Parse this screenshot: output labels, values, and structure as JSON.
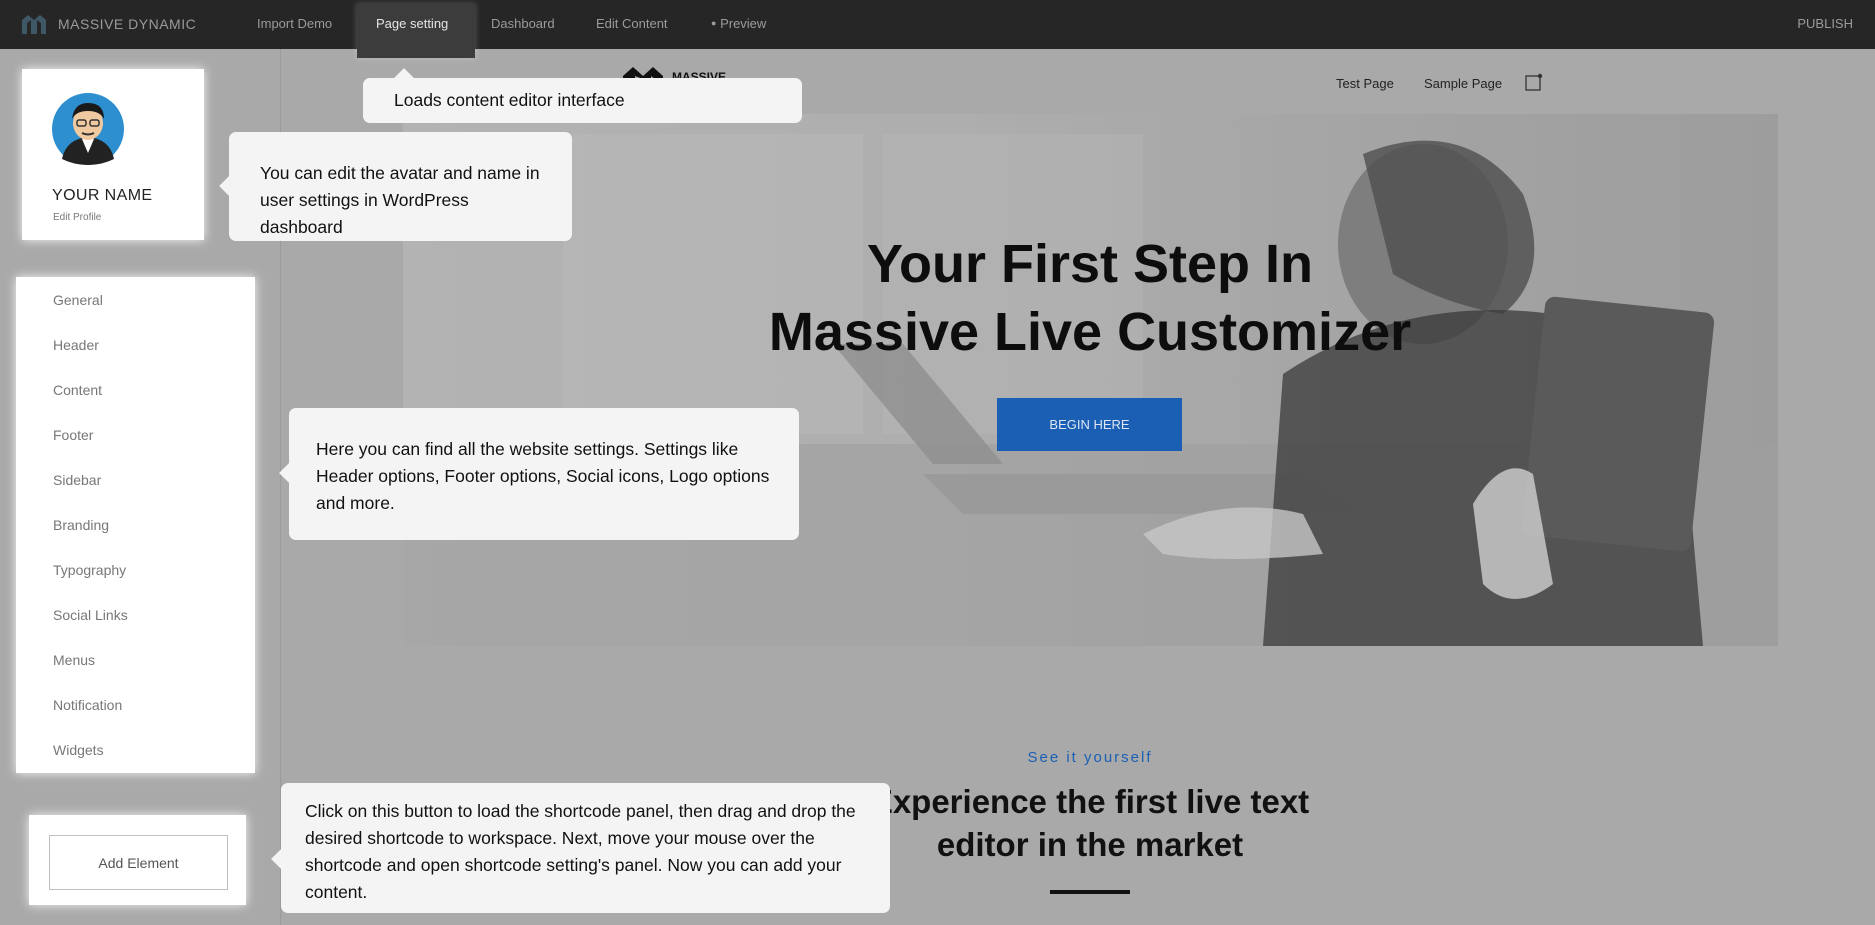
{
  "topbar": {
    "brand": "MASSIVE DYNAMIC",
    "nav": [
      "Import Demo",
      "Page setting",
      "Dashboard",
      "Edit Content",
      "Preview"
    ],
    "publish": "PUBLISH"
  },
  "profile": {
    "name": "YOUR NAME",
    "edit_link": "Edit Profile"
  },
  "menu": {
    "items": [
      "General",
      "Header",
      "Content",
      "Footer",
      "Sidebar",
      "Branding",
      "Typography",
      "Social Links",
      "Menus",
      "Notification",
      "Widgets"
    ]
  },
  "add_element": {
    "label": "Add Element"
  },
  "site": {
    "logo_text": "MASSIVE",
    "nav": [
      "Test Page",
      "Sample Page"
    ],
    "hero": {
      "title_line1": "Your First Step In",
      "title_line2": "Massive Live Customizer",
      "button": "BEGIN HERE"
    },
    "section": {
      "kicker": "See it yourself",
      "title_line1": "Experience the first live text",
      "title_line2": "editor in the market"
    }
  },
  "tooltips": {
    "loads": "Loads content editor interface",
    "avatar": "You can edit the avatar and name in user settings in WordPress dashboard",
    "settings": "Here you can find all the website settings. Settings like Header options, Footer options, Social icons, Logo options and more.",
    "element": "Click on this button to load the shortcode panel, then drag and drop the desired shortcode to workspace. Next, move your mouse over the shortcode and open shortcode setting's panel. Now you can add your content."
  },
  "colors": {
    "topbar": "#262626",
    "accent_blue": "#1a5fb4",
    "overlay": "#a9a9a9",
    "tooltip": "#f4f4f4"
  }
}
